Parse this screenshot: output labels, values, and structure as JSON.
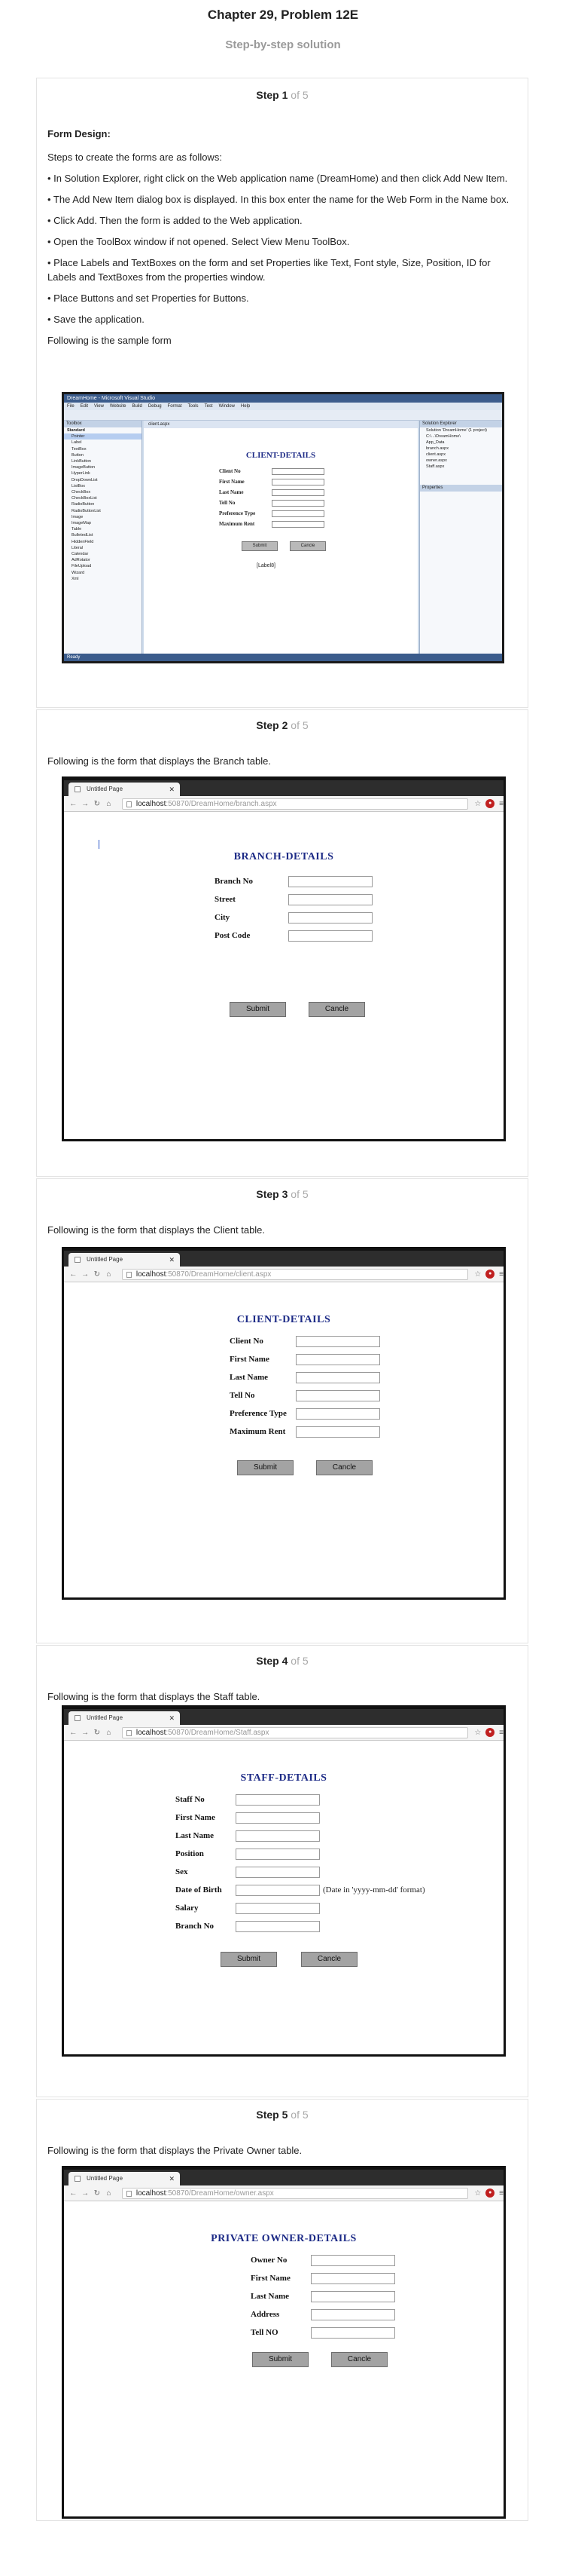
{
  "header": {
    "title": "Chapter 29, Problem 12E",
    "subtitle": "Step-by-step solution"
  },
  "step_word": "Step",
  "of_label": "of 5",
  "steps": [
    {
      "number": "1",
      "heading": "Form Design:",
      "intro": "Steps to create the forms are as follows:",
      "bullets": [
        "• In Solution Explorer, right click on the Web application name (DreamHome) and then click Add New Item.",
        "• The Add New Item dialog box is displayed. In this box enter the name for the Web Form in the Name box.",
        "• Click Add. Then the form is added to the Web application.",
        "• Open the ToolBox window if not opened. Select View Menu ToolBox.",
        "• Place Labels and TextBoxes on the form and set Properties like Text, Font style, Size, Position, ID for Labels and TextBoxes from the properties window.",
        "• Place Buttons and set Properties for Buttons.",
        "• Save the application."
      ],
      "caption": "Following is the sample form"
    },
    {
      "number": "2",
      "caption": "Following is the form that displays the Branch table."
    },
    {
      "number": "3",
      "caption": "Following is the form that displays the Client table."
    },
    {
      "number": "4",
      "caption": "Following is the form that displays the Staff table."
    },
    {
      "number": "5",
      "caption": "Following is the form that displays the Private Owner table."
    }
  ],
  "vs_screenshot": {
    "title": "DreamHome - Microsoft Visual Studio",
    "menu": [
      "File",
      "Edit",
      "View",
      "Website",
      "Build",
      "Debug",
      "Format",
      "Tools",
      "Test",
      "Window",
      "Help"
    ],
    "toolbox_header": "Toolbox",
    "toolbox_group": "Standard",
    "toolbox_items": [
      "Pointer",
      "Label",
      "TextBox",
      "Button",
      "LinkButton",
      "ImageButton",
      "HyperLink",
      "DropDownList",
      "ListBox",
      "CheckBox",
      "CheckBoxList",
      "RadioButton",
      "RadioButtonList",
      "Image",
      "ImageMap",
      "Table",
      "BulletedList",
      "HiddenField",
      "Literal",
      "Calendar",
      "AdRotator",
      "FileUpload",
      "Wizard",
      "Xml"
    ],
    "doc_tab": "client.aspx",
    "form_title": "CLIENT-DETAILS",
    "fields": [
      "Client No",
      "First Name",
      "Last Name",
      "Tell No",
      "Preference Type",
      "Maximum Rent"
    ],
    "submit": "Submit",
    "cancel": "Cancle",
    "label_control": "[Label8]",
    "solution_header": "Solution Explorer",
    "solution_items": [
      "Solution 'DreamHome' (1 project)",
      "C:\\...\\DreamHome\\",
      "App_Data",
      "branch.aspx",
      "client.aspx",
      "owner.aspx",
      "Staff.aspx"
    ],
    "properties_header": "Properties",
    "status": "Ready",
    "bottom_tabs": "Design | Split | Source"
  },
  "browser_tab_title": "Untitled Page",
  "url_domain": "localhost",
  "forms": [
    {
      "url_path": ":50870/DreamHome/branch.aspx",
      "title": "BRANCH-DETAILS",
      "fields": [
        "Branch No",
        "Street",
        "City",
        "Post Code"
      ],
      "submit": "Submit",
      "cancel": "Cancle"
    },
    {
      "url_path": ":50870/DreamHome/client.aspx",
      "title": "CLIENT-DETAILS",
      "fields": [
        "Client No",
        "First Name",
        "Last Name",
        "Tell No",
        "Preference Type",
        "Maximum Rent"
      ],
      "submit": "Submit",
      "cancel": "Cancle"
    },
    {
      "url_path": ":50870/DreamHome/Staff.aspx",
      "title": "STAFF-DETAILS",
      "fields": [
        "Staff No",
        "First Name",
        "Last Name",
        "Position",
        "Sex",
        "Date of Birth",
        "Salary",
        "Branch No"
      ],
      "dob_note": "(Date in 'yyyy-mm-dd' format)",
      "submit": "Submit",
      "cancel": "Cancle"
    },
    {
      "url_path": ":50870/DreamHome/owner.aspx",
      "title": "PRIVATE OWNER-DETAILS",
      "fields": [
        "Owner No",
        "First Name",
        "Last Name",
        "Address",
        "Tell NO"
      ],
      "submit": "Submit",
      "cancel": "Cancle"
    }
  ]
}
